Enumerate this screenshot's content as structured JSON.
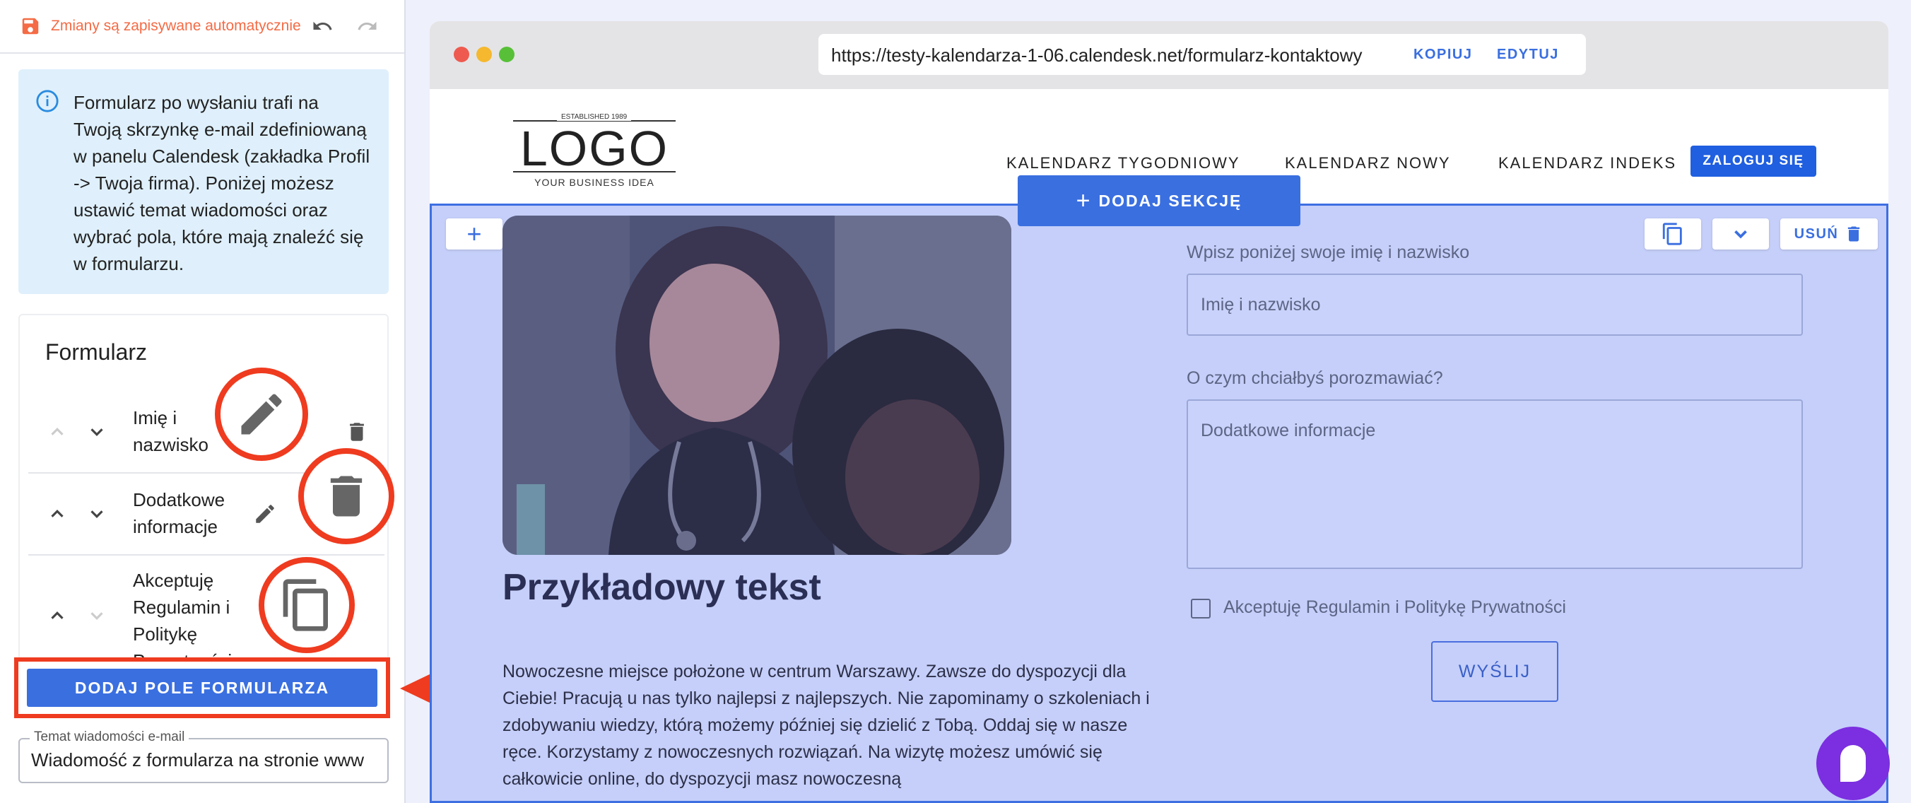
{
  "sidebar": {
    "autosave_text": "Zmiany są zapisywane automatycznie",
    "info_text": "Formularz po wysłaniu trafi na Twoją skrzynkę e-mail zdefiniowaną w panelu Calendesk (zakładka Profil -> Twoja firma). Poniżej możesz ustawić temat wiadomości oraz wybrać pola, które mają znaleźć się w formularzu.",
    "form_title": "Formularz",
    "fields": [
      {
        "label": "Imię i nazwisko"
      },
      {
        "label": "Dodatkowe informacje"
      },
      {
        "label": "Akceptuję Regulamin i Politykę Prywatności"
      }
    ],
    "add_field_button": "DODAJ POLE FORMULARZA",
    "email_subject_label": "Temat wiadomości e-mail",
    "email_subject_value": "Wiadomość z formularza na stronie www"
  },
  "browser": {
    "url": "https://testy-kalendarza-1-06.calendesk.net/formularz-kontaktowy",
    "copy_label": "KOPIUJ",
    "edit_label": "EDYTUJ"
  },
  "site": {
    "logo": {
      "established": "ESTABLISHED 1989",
      "text": "LOGO",
      "tagline": "YOUR BUSINESS IDEA"
    },
    "nav": [
      "KALENDARZ TYGODNIOWY",
      "KALENDARZ NOWY",
      "KALENDARZ INDEKS"
    ],
    "login_button": "ZALOGUJ SIĘ"
  },
  "section": {
    "add_section_button": "DODAJ SEKCJĘ",
    "delete_label": "USUŃ",
    "heading": "Przykładowy tekst",
    "paragraph": "Nowoczesne miejsce położone w centrum Warszawy. Zawsze do dyspozycji dla Ciebie! Pracują u nas tylko najlepsi z najlepszych. Nie zapominamy o szkoleniach i zdobywaniu wiedzy, którą możemy później się dzielić z Tobą. Oddaj się w nasze ręce. Korzystamy z nowoczesnych rozwiązań. Na wizytę możesz umówić się całkowicie online, do dyspozycji masz nowoczesną",
    "form": {
      "name_label": "Wpisz poniżej swoje imię i nazwisko",
      "name_placeholder": "Imię i nazwisko",
      "topic_label": "O czym chciałbyś porozmawiać?",
      "topic_placeholder": "Dodatkowe informacje",
      "consent_label": "Akceptuję Regulamin i Politykę Prywatności",
      "submit_label": "WYŚLIJ"
    }
  },
  "colors": {
    "accent": "#3a6fe0",
    "highlight": "#ef3b1f",
    "autosave": "#f46b45",
    "section_bg": "#c5cff9",
    "chat": "#7b2fe0"
  }
}
